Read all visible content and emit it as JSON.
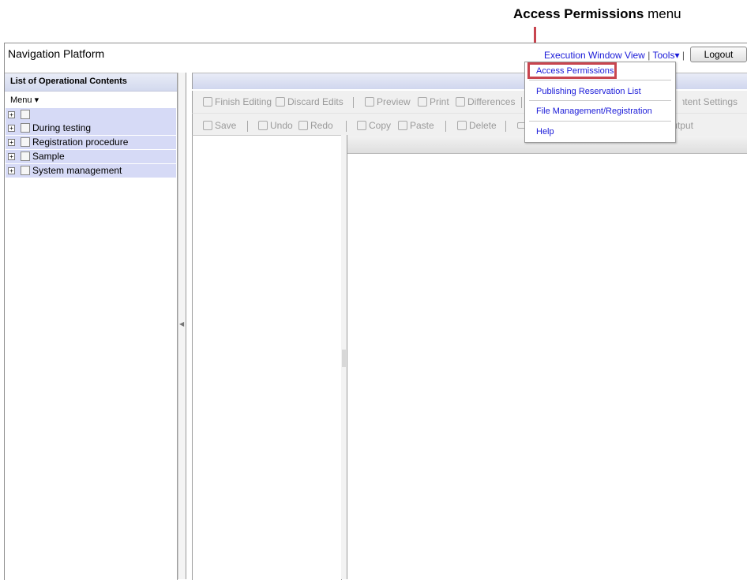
{
  "callout": {
    "bold": "Access Permissions",
    "rest": " menu"
  },
  "app": {
    "title": "Navigation Platform"
  },
  "header": {
    "execution_window_view": "Execution Window View",
    "separator": "|",
    "tools": "Tools",
    "tools_arrow": "▾",
    "logout": "Logout"
  },
  "left_panel": {
    "title": "List of Operational Contents",
    "menu_label": "Menu",
    "menu_arrow": "▾",
    "tree": [
      {
        "label": ""
      },
      {
        "label": "During testing"
      },
      {
        "label": "Registration procedure"
      },
      {
        "label": "Sample"
      },
      {
        "label": "System management"
      }
    ]
  },
  "toolbar1": {
    "finish_editing": "Finish Editing",
    "discard_edits": "Discard Edits",
    "preview": "Preview",
    "print": "Print",
    "differences": "Differences",
    "content_settings": "Content Settings"
  },
  "toolbar2": {
    "save": "Save",
    "undo": "Undo",
    "redo": "Redo",
    "copy": "Copy",
    "paste": "Paste",
    "delete": "Delete",
    "output": "Output"
  },
  "tools_menu": {
    "items": [
      "Access Permissions",
      "Publishing Reservation List",
      "File Management/Registration",
      "Help"
    ]
  },
  "colors": {
    "highlight": "#c8454f",
    "link": "#1a1ad8",
    "tree_row": "#d6daf6"
  }
}
